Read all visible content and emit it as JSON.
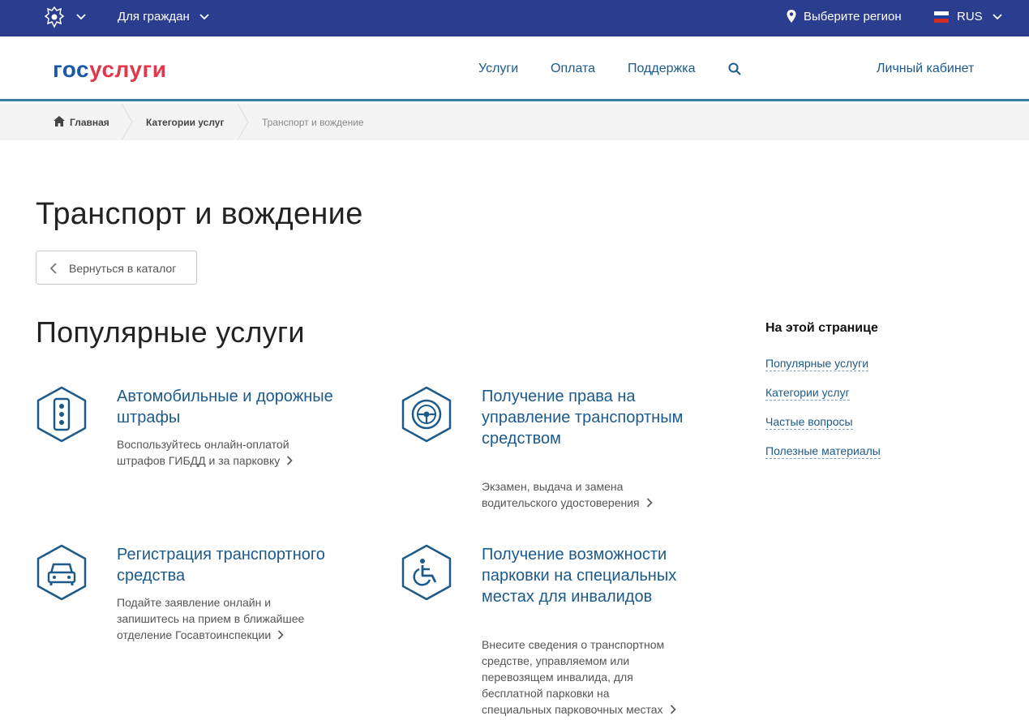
{
  "topbar": {
    "for_citizens": "Для граждан",
    "region": "Выберите регион",
    "lang": "RUS",
    "bg_color": "#2a3d8f"
  },
  "header": {
    "logo_part1": "гос",
    "logo_part2": "услуги",
    "nav": [
      "Услуги",
      "Оплата",
      "Поддержка"
    ],
    "cabinet": "Личный кабинет"
  },
  "breadcrumb": {
    "home": "Главная",
    "categories": "Категории услуг",
    "current": "Транспорт и вождение"
  },
  "page": {
    "title": "Транспорт и вождение",
    "back_button": "Вернуться в каталог",
    "popular_heading": "Популярные услуги"
  },
  "services": [
    {
      "icon": "traffic-light-icon",
      "title": "Автомобильные и дорожные штрафы",
      "desc": [
        "Воспользуйтесь онлайн-оплатой",
        "штрафов ГИБДД и за парковку"
      ]
    },
    {
      "icon": "steering-wheel-icon",
      "title": "Получение права на управление транспортным средством",
      "desc": [
        "Экзамен, выдача и замена",
        "водительского удостоверения"
      ]
    },
    {
      "icon": "car-icon",
      "title": "Регистрация транспортного средства",
      "desc": [
        "Подайте заявление онлайн и",
        "запишитесь на прием в ближайшее",
        "отделение Госавтоинспекции"
      ]
    },
    {
      "icon": "wheelchair-icon",
      "title": "Получение возможности парковки на специальных местах для инвалидов",
      "desc": [
        "Внесите сведения о транспортном",
        "средстве, управляемом или",
        "перевозящем инвалида, для",
        "бесплатной парковки на",
        "специальных парковочных местах"
      ]
    }
  ],
  "toc": {
    "title": "На этой странице",
    "links": [
      "Популярные услуги",
      "Категории услуг",
      "Частые вопросы",
      "Полезные материалы"
    ]
  }
}
